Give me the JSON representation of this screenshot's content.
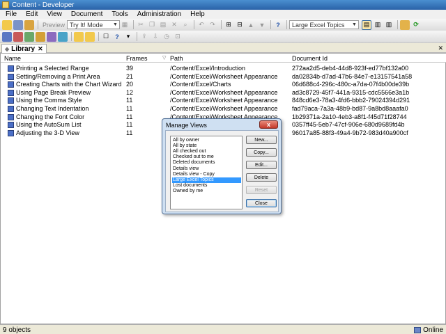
{
  "window": {
    "title": "Content - Developer"
  },
  "menu": [
    "File",
    "Edit",
    "View",
    "Document",
    "Tools",
    "Administration",
    "Help"
  ],
  "toolbar": {
    "preview_label": "Preview",
    "try_mode_value": "Try It! Mode",
    "view_select_value": "Large Excel Topics"
  },
  "tabs": {
    "library_label": "Library"
  },
  "grid": {
    "columns": [
      "Name",
      "Frames",
      "Path",
      "Document Id"
    ],
    "rows": [
      {
        "name": "Printing a Selected Range",
        "frames": "39",
        "path": "/Content/Excel/Introduction",
        "id": "272aa2d5-deb4-44d8-923f-ed77bf132a00"
      },
      {
        "name": "Setting/Removing a Print Area",
        "frames": "21",
        "path": "/Content/Excel/Worksheet Appearance",
        "id": "da02834b-d7ad-47b6-84e7-e13157541a58"
      },
      {
        "name": "Creating Charts with the Chart Wizard",
        "frames": "20",
        "path": "/Content/Excel/Charts",
        "id": "06d688c4-296c-480c-a7da-07f4b00de39b"
      },
      {
        "name": "Using Page Break Preview",
        "frames": "12",
        "path": "/Content/Excel/Worksheet Appearance",
        "id": "ad3c8729-45f7-441a-9315-cdc5566e3a1b"
      },
      {
        "name": "Using the Comma Style",
        "frames": "11",
        "path": "/Content/Excel/Worksheet Appearance",
        "id": "848cd6e3-78a3-4fd6-bbb2-79024394d291"
      },
      {
        "name": "Changing Text Indentation",
        "frames": "11",
        "path": "/Content/Excel/Worksheet Appearance",
        "id": "fad79aca-7a3a-48b9-bd87-9a8bd8aaafa0"
      },
      {
        "name": "Changing the Font Color",
        "frames": "11",
        "path": "/Content/Excel/Worksheet Appearance",
        "id": "1b29371a-2a10-4eb3-a8f1-f45d71f28744"
      },
      {
        "name": "Using the AutoSum List",
        "frames": "11",
        "path": "",
        "id": "0357ff45-5eb7-47cf-906e-680d9689fd4b"
      },
      {
        "name": "Adjusting the 3-D View",
        "frames": "11",
        "path": "",
        "id": "96017a85-88f3-49a4-9b72-983d40a900cf"
      }
    ]
  },
  "status": {
    "count": "9 objects",
    "online": "Online"
  },
  "dialog": {
    "title": "Manage Views",
    "close": "x",
    "views": [
      "All by owner",
      "All by state",
      "All checked out",
      "Checked out to me",
      "Deleted documents",
      "Details view",
      "Details view - Copy",
      "Large Excel Topics",
      "Lost documents",
      "Owned by me"
    ],
    "selected_index": 7,
    "buttons": {
      "new": "New...",
      "copy": "Copy...",
      "edit": "Edit...",
      "delete": "Delete",
      "reset": "Reset",
      "close": "Close"
    }
  }
}
